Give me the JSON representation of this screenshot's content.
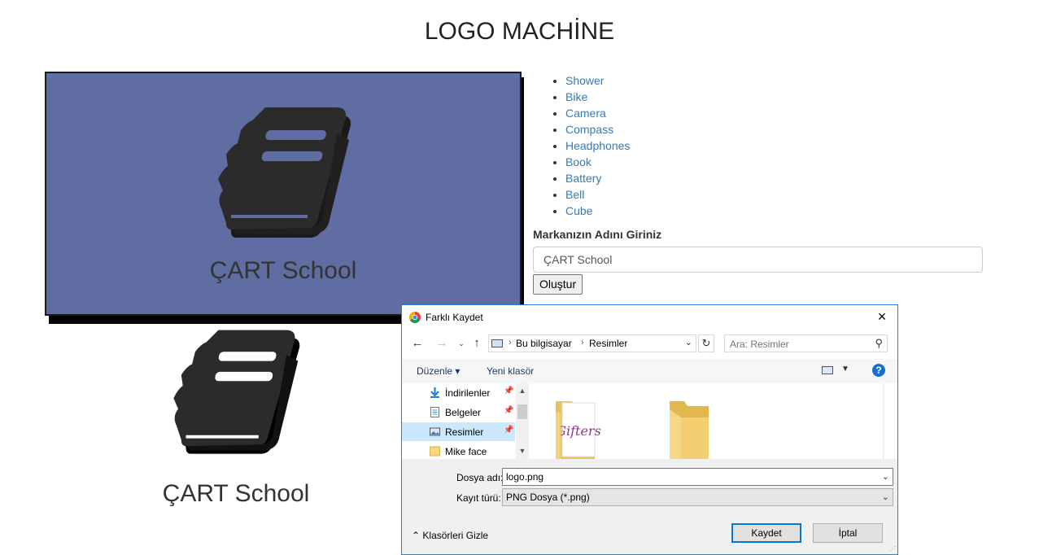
{
  "page": {
    "title": "LOGO MACHİNE",
    "brand_name": "ÇART School",
    "logo_bg_color": "#606da2",
    "icon": "book-icon"
  },
  "icon_list": [
    "Shower",
    "Bike",
    "Camera",
    "Compass",
    "Headphones",
    "Book",
    "Battery",
    "Bell",
    "Cube"
  ],
  "form": {
    "label": "Markanızın Adını Giriniz",
    "input_value": "ÇART School",
    "submit_label": "Oluştur"
  },
  "dialog": {
    "title": "Farklı Kaydet",
    "close_icon": "×",
    "breadcrumb": [
      "Bu bilgisayar",
      "Resimler"
    ],
    "search_placeholder": "Ara: Resimler",
    "toolbar": {
      "organize": "Düzenle",
      "new_folder": "Yeni klasör"
    },
    "nav_items": [
      {
        "label": "İndirilenler",
        "icon": "download-icon"
      },
      {
        "label": "Belgeler",
        "icon": "document-icon"
      },
      {
        "label": "Resimler",
        "icon": "pictures-icon",
        "selected": true
      },
      {
        "label": "Mike face",
        "icon": "folder-icon"
      }
    ],
    "folder_thumbnail_text": "Gifters",
    "filename_label": "Dosya adı:",
    "filename_value": "logo.png",
    "filetype_label": "Kayıt türü:",
    "filetype_value": "PNG Dosya (*.png)",
    "hide_folders": "Klasörleri Gizle",
    "save_label": "Kaydet",
    "cancel_label": "İptal"
  }
}
